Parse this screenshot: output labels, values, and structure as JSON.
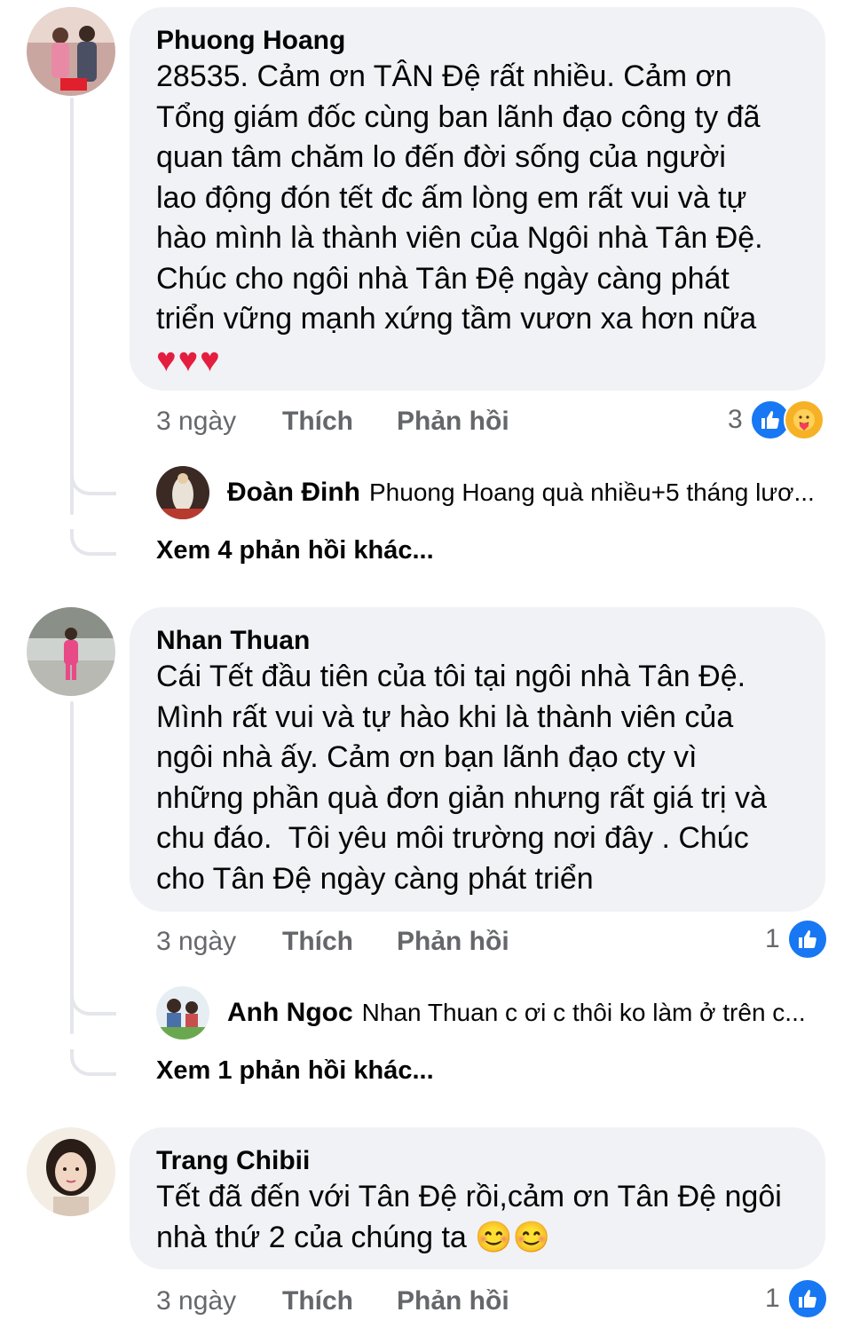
{
  "comments": [
    {
      "author": "Phuong Hoang",
      "text": "28535. Cảm ơn TÂN Đệ rất nhiều. Cảm ơn\nTổng giám đốc cùng ban lãnh đạo công ty đã\nquan tâm chăm lo đến đời sống của người\nlao động đón tết đc ấm lòng em rất vui và tự\nhào mình là thành viên của Ngôi nhà Tân Đệ.\nChúc cho ngôi nhà Tân Đệ ngày càng phát\ntriển vững mạnh xứng tầm vươn xa hơn nữa",
      "emoji": "♥♥♥",
      "time": "3 ngày",
      "like_label": "Thích",
      "reply_label": "Phản hồi",
      "reaction_count": "3",
      "reaction_icons": [
        "like-icon",
        "care-icon"
      ],
      "reply_preview": {
        "author": "Đoàn Đinh",
        "text": "Phuong Hoang quà nhiều+5 tháng lươ..."
      },
      "more_replies": "Xem 4 phản hồi khác..."
    },
    {
      "author": "Nhan Thuan",
      "text": "Cái Tết đầu tiên của tôi tại ngôi nhà Tân Đệ.\nMình rất vui và tự hào khi là thành viên của\nngôi nhà ấy. Cảm ơn bạn lãnh đạo cty vì\nnhững phần quà đơn giản nhưng rất giá trị và\nchu đáo.  Tôi yêu môi trường nơi đây . Chúc\ncho Tân Đệ ngày càng phát triển",
      "time": "3 ngày",
      "like_label": "Thích",
      "reply_label": "Phản hồi",
      "reaction_count": "1",
      "reaction_icons": [
        "like-icon"
      ],
      "reply_preview": {
        "author": "Anh Ngoc",
        "text": "Nhan Thuan  c ơi c thôi ko làm ở trên c..."
      },
      "more_replies": "Xem 1 phản hồi khác..."
    },
    {
      "author": "Trang Chibii",
      "text": "Tết đã đến với Tân Đệ rồi,cảm ơn Tân Đệ ngôi\nnhà thứ 2 của chúng ta 😊😊",
      "time": "3 ngày",
      "like_label": "Thích",
      "reply_label": "Phản hồi",
      "reaction_count": "1",
      "reaction_icons": [
        "like-icon"
      ]
    }
  ],
  "colors": {
    "bubble": "#f0f2f5",
    "like_blue": "#1877f2",
    "meta_gray": "#65676b",
    "heart_red": "#e41e3f"
  }
}
